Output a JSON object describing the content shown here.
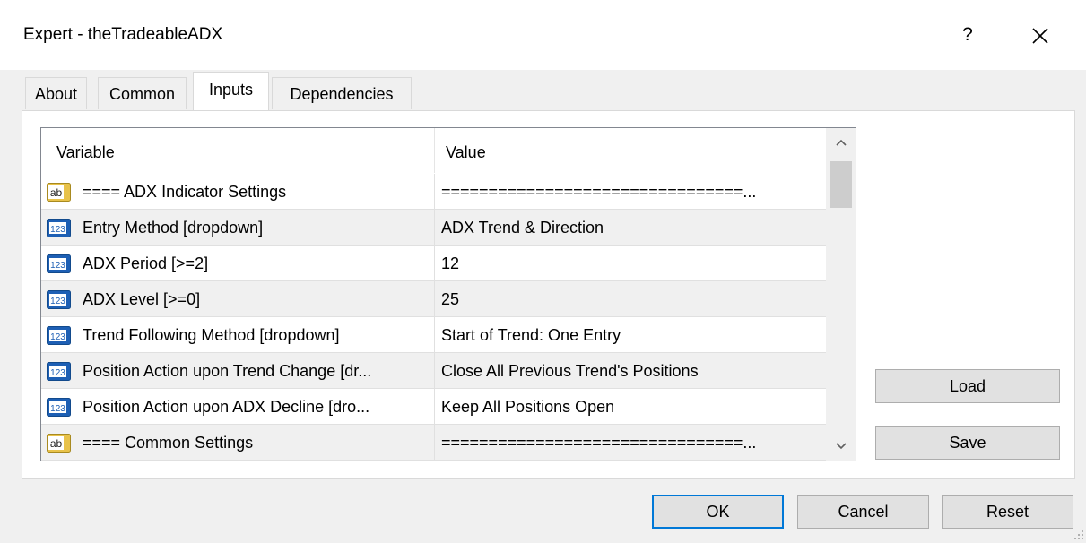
{
  "window": {
    "title": "Expert - theTradeableADX",
    "help_glyph": "?",
    "close_icon": "close-icon"
  },
  "tabs": [
    {
      "label": "About",
      "active": false
    },
    {
      "label": "Common",
      "active": false
    },
    {
      "label": "Inputs",
      "active": true
    },
    {
      "label": "Dependencies",
      "active": false
    }
  ],
  "grid": {
    "columns": [
      "Variable",
      "Value"
    ],
    "rows": [
      {
        "type": "ab",
        "variable": "==== ADX Indicator Settings",
        "value": "================================..."
      },
      {
        "type": "123",
        "variable": "Entry Method [dropdown]",
        "value": "ADX Trend & Direction"
      },
      {
        "type": "123",
        "variable": "ADX Period [>=2]",
        "value": "12"
      },
      {
        "type": "123",
        "variable": "ADX Level [>=0]",
        "value": "25"
      },
      {
        "type": "123",
        "variable": "Trend Following Method [dropdown]",
        "value": "Start of Trend: One Entry"
      },
      {
        "type": "123",
        "variable": "Position Action upon Trend Change [dr...",
        "value": "Close All Previous Trend's Positions"
      },
      {
        "type": "123",
        "variable": "Position Action upon ADX Decline [dro...",
        "value": "Keep All Positions Open"
      },
      {
        "type": "ab",
        "variable": "==== Common Settings",
        "value": "================================..."
      }
    ],
    "scroll_position": 0.0
  },
  "side_buttons": {
    "load": "Load",
    "save": "Save"
  },
  "footer_buttons": {
    "ok": "OK",
    "cancel": "Cancel",
    "reset": "Reset"
  },
  "colors": {
    "accent": "#0078d7",
    "ab_icon": "#e8c24a",
    "num_icon": "#1d5fb4"
  }
}
